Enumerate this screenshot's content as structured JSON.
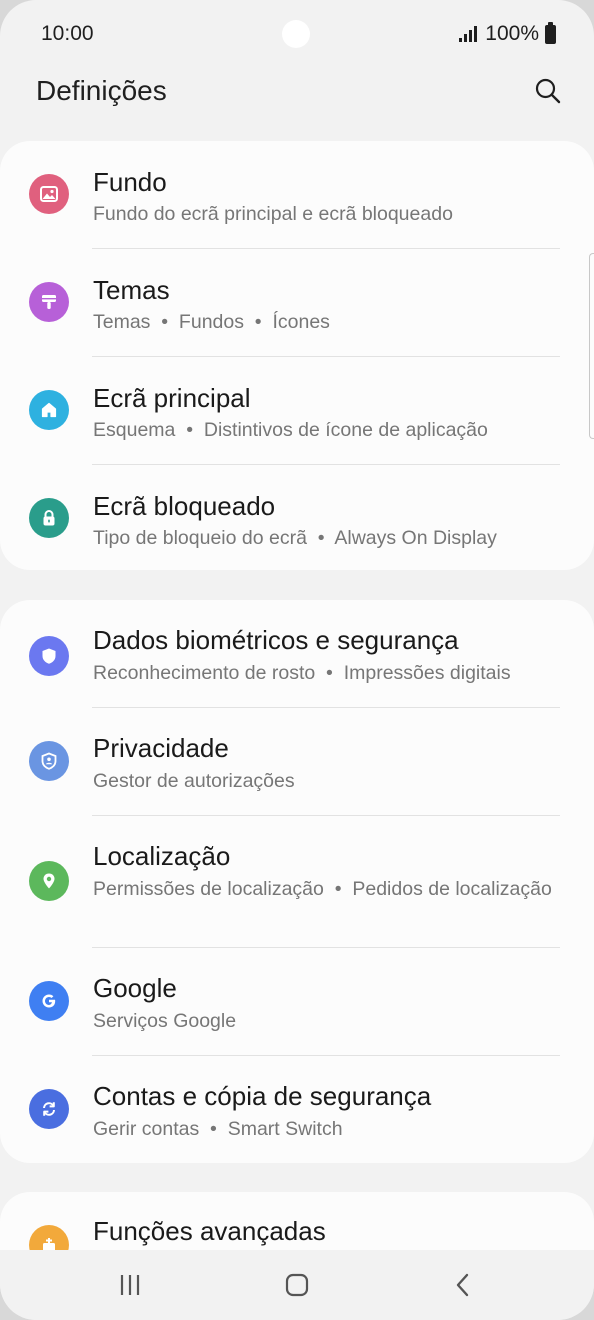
{
  "status_bar": {
    "time": "10:00",
    "battery": "100%"
  },
  "header": {
    "title": "Definições",
    "search_icon": "search-icon"
  },
  "sections": [
    {
      "items": [
        {
          "title": "Fundo",
          "subtitle": "Fundo do ecrã principal e ecrã bloqueado",
          "icon": "wallpaper-icon",
          "color": "#e0607e"
        },
        {
          "title": "Temas",
          "subtitle": "Temas  •  Fundos  •  Ícones",
          "icon": "themes-icon",
          "color": "#b760d8"
        },
        {
          "title": "Ecrã principal",
          "subtitle": "Esquema  •  Distintivos de ícone de aplicação",
          "icon": "home-icon",
          "color": "#2eb1e0"
        },
        {
          "title": "Ecrã bloqueado",
          "subtitle": "Tipo de bloqueio do ecrã  •  Always On Display",
          "icon": "lock-icon",
          "color": "#2a9d8b"
        }
      ]
    },
    {
      "items": [
        {
          "title": "Dados biométricos e segurança",
          "subtitle": "Reconhecimento de rosto  •  Impressões digitais",
          "icon": "shield-icon",
          "color": "#6b78f0"
        },
        {
          "title": "Privacidade",
          "subtitle": "Gestor de autorizações",
          "icon": "privacy-icon",
          "color": "#6a95e2"
        },
        {
          "title": "Localização",
          "subtitle": "Permissões de localização  •  Pedidos de localização",
          "icon": "location-icon",
          "color": "#5cb85c"
        },
        {
          "title": "Google",
          "subtitle": "Serviços Google",
          "icon": "google-icon",
          "color": "#3f7ff2"
        },
        {
          "title": "Contas e cópia de segurança",
          "subtitle": "Gerir contas  •  Smart Switch",
          "icon": "sync-icon",
          "color": "#4a6ee0"
        }
      ]
    },
    {
      "items": [
        {
          "title": "Funções avançadas",
          "subtitle": "",
          "icon": "advanced-features-icon",
          "color": "#f2a93b"
        }
      ]
    }
  ],
  "nav": {
    "recents": "recents-icon",
    "home": "home-button-icon",
    "back": "back-icon"
  }
}
